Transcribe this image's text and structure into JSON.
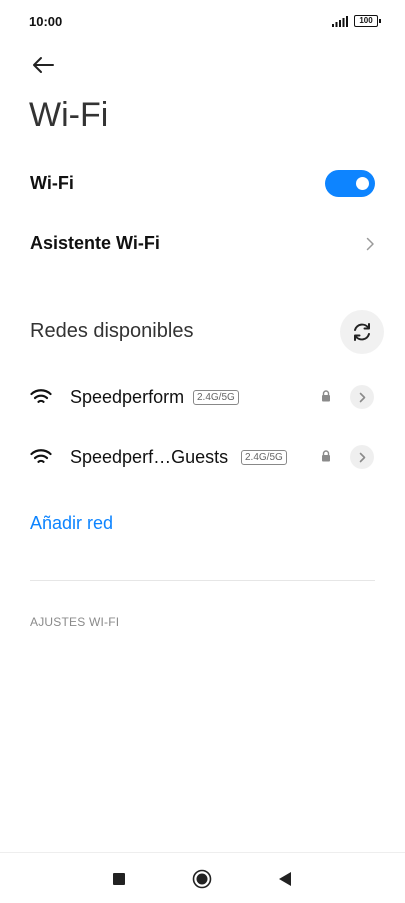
{
  "status_bar": {
    "time": "10:00",
    "battery": "100",
    "signal_icon": "signal-bars-icon",
    "battery_icon": "battery-icon"
  },
  "header": {
    "back_icon": "arrow-left-icon",
    "title": "Wi-Fi"
  },
  "wifi_toggle": {
    "label": "Wi-Fi",
    "enabled": true,
    "accent_color": "#0d84ff"
  },
  "assistant": {
    "label": "Asistente Wi-Fi",
    "chevron_icon": "chevron-right-icon"
  },
  "available_networks": {
    "label": "Redes disponibles",
    "refresh_icon": "refresh-icon",
    "networks": [
      {
        "name": "Speedperform",
        "band": "2.4G/5G",
        "secured": true
      },
      {
        "name": "Speedperf…Guests",
        "band": "2.4G/5G",
        "secured": true
      }
    ]
  },
  "add_network": {
    "label": "Añadir red",
    "color": "#0d84ff"
  },
  "wifi_settings": {
    "header": "AJUSTES WI-FI"
  },
  "nav_bar": {
    "recents_icon": "square-icon",
    "home_icon": "circle-icon",
    "back_icon": "triangle-back-icon"
  }
}
